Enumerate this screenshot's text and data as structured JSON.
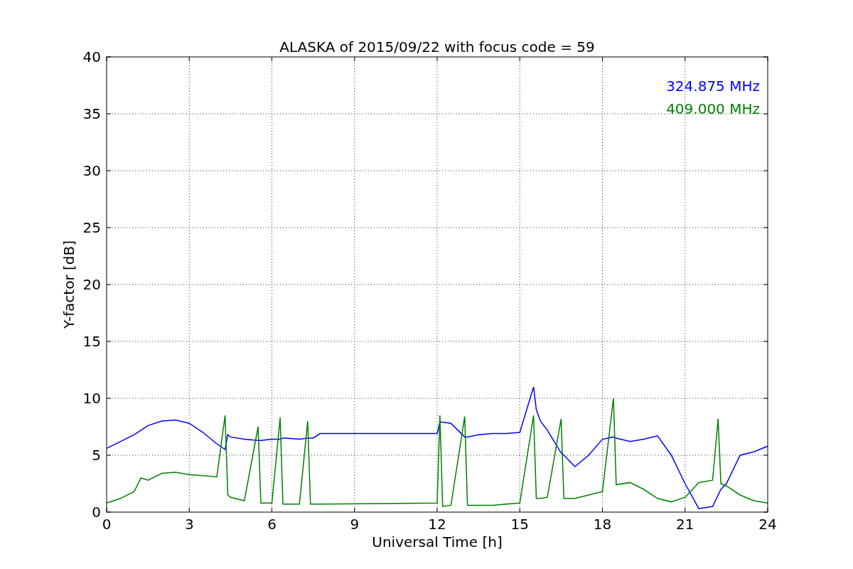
{
  "figure": {
    "chart_data": {
      "type": "line",
      "title": "ALASKA of 2015/09/22 with focus code = 59",
      "xlabel": "Universal Time [h]",
      "ylabel": "Y-factor [dB]",
      "xlim": [
        0,
        24
      ],
      "ylim": [
        0,
        40
      ],
      "xticks": [
        0,
        3,
        6,
        9,
        12,
        15,
        18,
        21,
        24
      ],
      "yticks": [
        0,
        5,
        10,
        15,
        20,
        25,
        30,
        35,
        40
      ],
      "grid": true,
      "x": [
        0,
        0.5,
        1,
        1.25,
        1.5,
        2,
        2.5,
        3,
        3.5,
        4,
        4.3,
        4.4,
        4.5,
        5,
        5.5,
        5.6,
        6,
        6.3,
        6.4,
        6.5,
        7,
        7.3,
        7.4,
        7.5,
        7.75,
        12,
        12.1,
        12.2,
        12.5,
        13,
        13.1,
        13.5,
        14,
        14.5,
        15,
        15.5,
        15.6,
        15.75,
        16,
        16.5,
        16.6,
        17,
        17.5,
        18,
        18.4,
        18.5,
        19,
        19.5,
        20,
        20.5,
        21,
        21.5,
        22,
        22.2,
        22.3,
        22.5,
        23,
        23.5,
        24
      ],
      "series": [
        {
          "name": "324.875 MHz",
          "color": "#0000ff",
          "values": [
            5.6,
            6.2,
            6.8,
            7.2,
            7.6,
            8.0,
            8.1,
            7.8,
            7.0,
            6.0,
            5.5,
            6.8,
            6.6,
            6.4,
            6.3,
            6.3,
            6.4,
            6.4,
            6.5,
            6.5,
            6.4,
            6.5,
            6.5,
            6.5,
            6.9,
            6.9,
            7.9,
            7.9,
            7.8,
            6.6,
            6.6,
            6.8,
            6.9,
            6.9,
            7.0,
            11.0,
            9.0,
            8.0,
            7.2,
            5.2,
            5.0,
            4.0,
            5.0,
            6.4,
            6.6,
            6.5,
            6.2,
            6.4,
            6.7,
            5.0,
            2.5,
            0.3,
            0.5,
            1.5,
            2.0,
            2.5,
            5.0,
            5.3,
            5.8
          ]
        },
        {
          "name": "409.000 MHz",
          "color": "#008000",
          "values": [
            0.8,
            1.2,
            1.8,
            3.0,
            2.8,
            3.4,
            3.5,
            3.3,
            3.2,
            3.1,
            8.5,
            1.5,
            1.3,
            1.0,
            7.5,
            0.8,
            0.8,
            8.3,
            0.7,
            0.7,
            0.7,
            8.0,
            0.7,
            0.7,
            0.7,
            0.8,
            8.5,
            0.5,
            0.6,
            8.4,
            0.6,
            0.6,
            0.6,
            0.7,
            0.8,
            8.5,
            1.2,
            1.2,
            1.3,
            8.2,
            1.2,
            1.2,
            1.5,
            1.8,
            10.0,
            2.4,
            2.6,
            2.0,
            1.2,
            0.9,
            1.3,
            2.6,
            2.8,
            8.2,
            2.5,
            2.3,
            1.5,
            1.0,
            0.8
          ]
        }
      ]
    }
  }
}
